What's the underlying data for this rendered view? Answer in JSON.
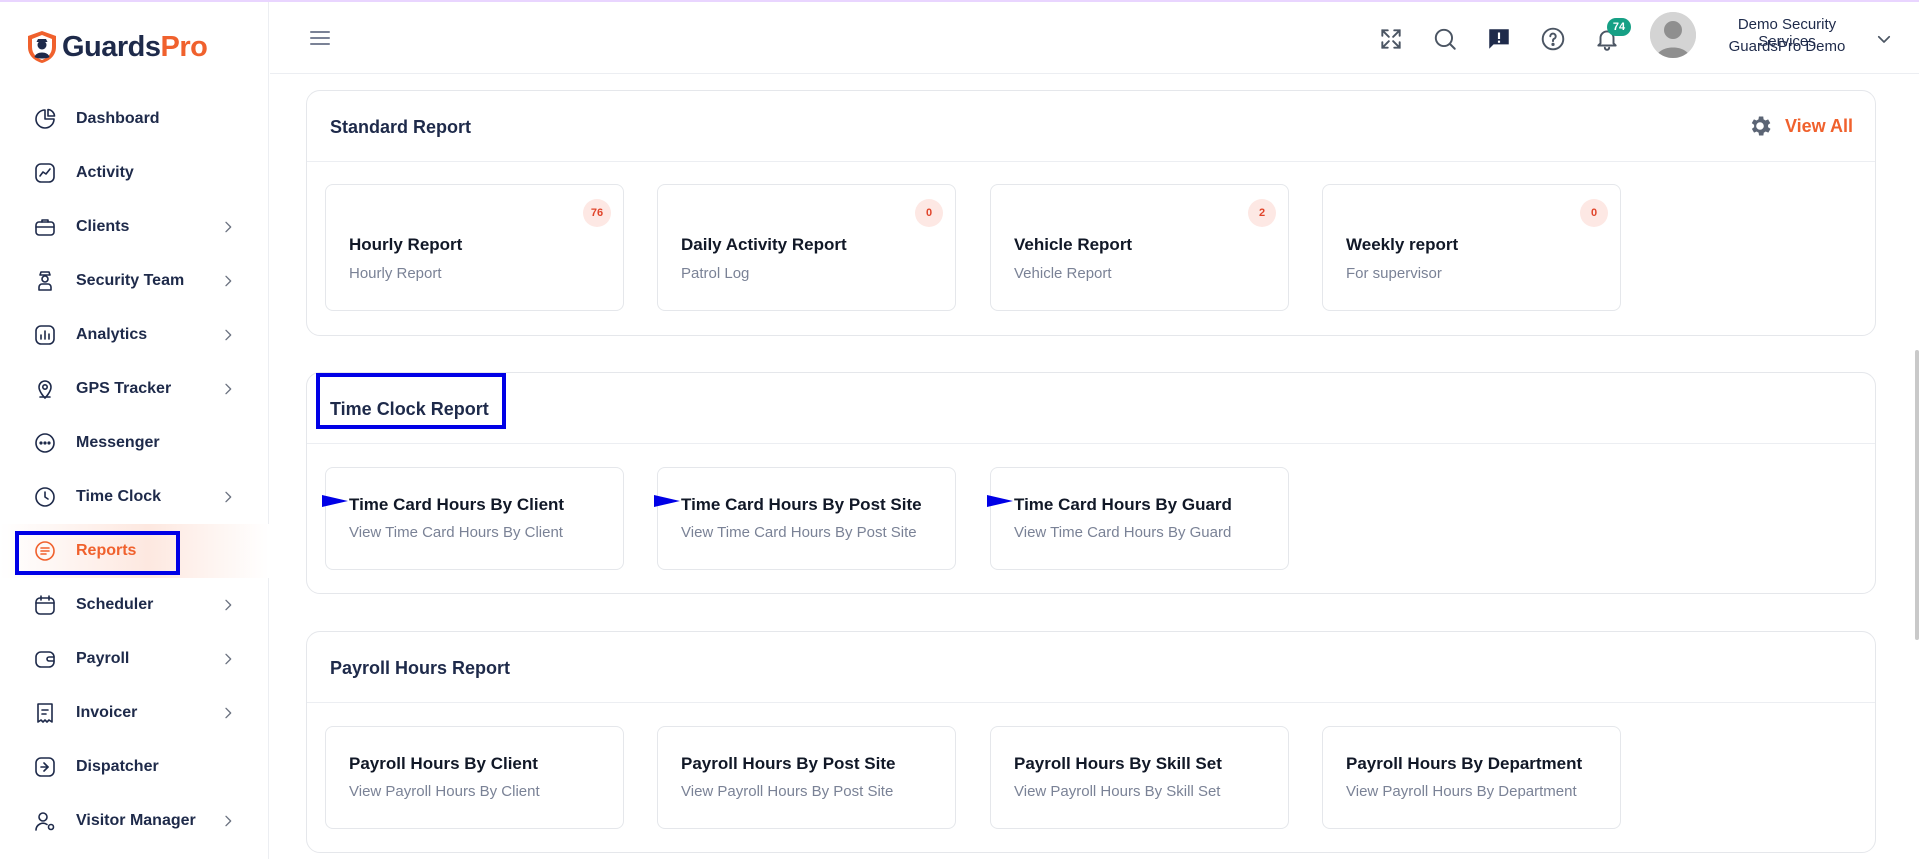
{
  "app": {
    "logo_part1": "Guards",
    "logo_part2": "Pro"
  },
  "sidebar": {
    "items": [
      {
        "label": "Dashboard",
        "icon": "pie-chart-icon",
        "has_chevron": false
      },
      {
        "label": "Activity",
        "icon": "activity-chart-icon",
        "has_chevron": false
      },
      {
        "label": "Clients",
        "icon": "briefcase-icon",
        "has_chevron": true
      },
      {
        "label": "Security Team",
        "icon": "guard-icon",
        "has_chevron": true
      },
      {
        "label": "Analytics",
        "icon": "bar-chart-icon",
        "has_chevron": true
      },
      {
        "label": "GPS Tracker",
        "icon": "map-pin-icon",
        "has_chevron": true
      },
      {
        "label": "Messenger",
        "icon": "chat-icon",
        "has_chevron": false
      },
      {
        "label": "Time Clock",
        "icon": "clock-icon",
        "has_chevron": true
      },
      {
        "label": "Reports",
        "icon": "report-icon",
        "has_chevron": false,
        "active": true
      },
      {
        "label": "Scheduler",
        "icon": "calendar-icon",
        "has_chevron": true
      },
      {
        "label": "Payroll",
        "icon": "wallet-icon",
        "has_chevron": true
      },
      {
        "label": "Invoicer",
        "icon": "invoice-icon",
        "has_chevron": true
      },
      {
        "label": "Dispatcher",
        "icon": "dispatch-icon",
        "has_chevron": false
      },
      {
        "label": "Visitor Manager",
        "icon": "visitor-icon",
        "has_chevron": true
      }
    ]
  },
  "header": {
    "notification_count": "74",
    "user_company": "Demo Security Services",
    "user_name": "GuardsPro Demo"
  },
  "standard_report": {
    "title": "Standard Report",
    "view_all": "View All",
    "cards": [
      {
        "title": "Hourly Report",
        "subtitle": "Hourly Report",
        "count": "76"
      },
      {
        "title": "Daily Activity Report",
        "subtitle": "Patrol Log",
        "count": "0"
      },
      {
        "title": "Vehicle Report",
        "subtitle": "Vehicle Report",
        "count": "2"
      },
      {
        "title": "Weekly report",
        "subtitle": "For supervisor",
        "count": "0"
      }
    ]
  },
  "time_clock_report": {
    "title": "Time Clock Report",
    "cards": [
      {
        "title": "Time Card Hours By Client",
        "subtitle": "View Time Card Hours By Client"
      },
      {
        "title": "Time Card Hours By Post Site",
        "subtitle": "View Time Card Hours By Post Site"
      },
      {
        "title": "Time Card Hours By Guard",
        "subtitle": "View Time Card Hours By Guard"
      }
    ]
  },
  "payroll_hours_report": {
    "title": "Payroll Hours Report",
    "cards": [
      {
        "title": "Payroll Hours By Client",
        "subtitle": "View Payroll Hours By Client"
      },
      {
        "title": "Payroll Hours By Post Site",
        "subtitle": "View Payroll Hours By Post Site"
      },
      {
        "title": "Payroll Hours By Skill Set",
        "subtitle": "View Payroll Hours By Skill Set"
      },
      {
        "title": "Payroll Hours By Department",
        "subtitle": "View Payroll Hours By Department"
      }
    ]
  },
  "colors": {
    "brand_orange": "#f0612d",
    "navy": "#1e2a4a",
    "highlight_blue": "#0000e6",
    "badge_teal": "#16a085"
  }
}
